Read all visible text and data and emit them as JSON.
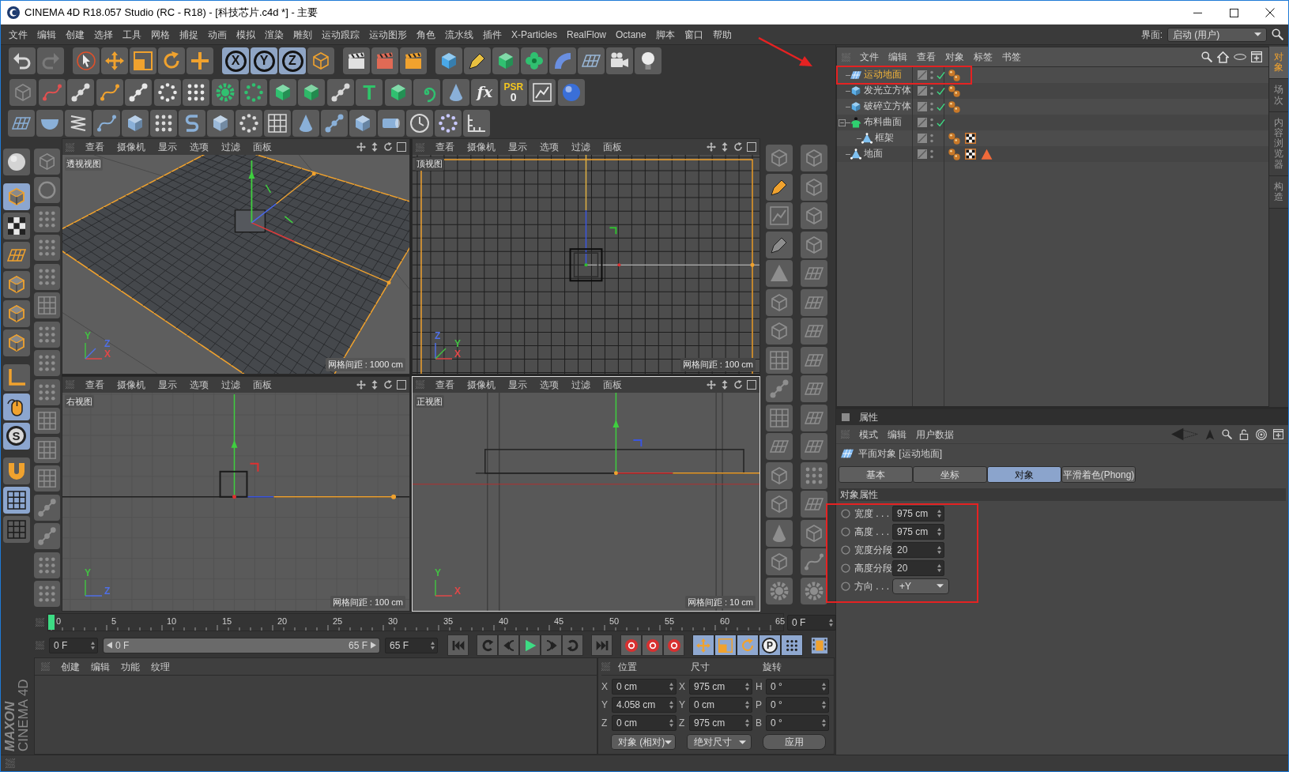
{
  "window": {
    "title": "CINEMA 4D R18.057 Studio (RC - R18) - [科技芯片.c4d *] - 主要"
  },
  "menu_bar": {
    "items": [
      "文件",
      "编辑",
      "创建",
      "选择",
      "工具",
      "网格",
      "捕捉",
      "动画",
      "模拟",
      "渲染",
      "雕刻",
      "运动跟踪",
      "运动图形",
      "角色",
      "流水线",
      "插件",
      "X-Particles",
      "RealFlow",
      "Octane",
      "脚本",
      "窗口",
      "帮助"
    ],
    "layout_label": "界面:",
    "layout_value": "启动 (用户)"
  },
  "toolbar": {
    "axis_buttons": [
      {
        "label": "X",
        "on": true
      },
      {
        "label": "Y",
        "on": true
      },
      {
        "label": "Z",
        "on": true
      }
    ],
    "text_tool": "T",
    "fx": "fx",
    "psr": {
      "label": "PSR",
      "value": "0"
    }
  },
  "left_toolbar": {
    "tools": [
      {
        "kind": "sphere",
        "selected": false
      },
      {
        "kind": "cube",
        "selected": true
      },
      {
        "kind": "checker",
        "selected": false
      },
      {
        "kind": "grid-plane",
        "selected": false
      },
      {
        "kind": "cube",
        "selected": false
      },
      {
        "kind": "cube",
        "selected": false
      },
      {
        "kind": "cube",
        "selected": false
      },
      {
        "kind": "axis",
        "selected": false
      },
      {
        "kind": "mouse",
        "selected": true
      },
      {
        "kind": "snap",
        "label": "S",
        "selected": true
      },
      {
        "kind": "magnet",
        "selected": false
      },
      {
        "kind": "grid",
        "selected": true
      },
      {
        "kind": "grid",
        "selected": false
      }
    ]
  },
  "viewports": [
    {
      "kind": "perspective",
      "active": false,
      "menu": [
        "查看",
        "摄像机",
        "显示",
        "选项",
        "过滤",
        "面板"
      ],
      "name": "透视视图",
      "grid_spacing": "网格间距 : 1000 cm",
      "axes": [
        {
          "label": "Y",
          "color": "#43c043"
        },
        {
          "label": "Z",
          "color": "#4f6fe6"
        },
        {
          "label": "X",
          "color": "#e04848"
        }
      ]
    },
    {
      "kind": "top",
      "active": false,
      "menu": [
        "查看",
        "摄像机",
        "显示",
        "选项",
        "过滤",
        "面板"
      ],
      "name": "顶视图",
      "grid_spacing": "网格间距 : 100 cm",
      "axes": [
        {
          "label": "Z",
          "color": "#4f6fe6"
        },
        {
          "label": "Y",
          "color": "#43c043"
        },
        {
          "label": "X",
          "color": "#e04848"
        }
      ]
    },
    {
      "kind": "right",
      "active": false,
      "menu": [
        "查看",
        "摄像机",
        "显示",
        "选项",
        "过滤",
        "面板"
      ],
      "name": "右视图",
      "grid_spacing": "网格间距 : 100 cm",
      "axes": [
        {
          "label": "Y",
          "color": "#43c043"
        },
        {
          "label": "Z",
          "color": "#4f6fe6"
        }
      ]
    },
    {
      "kind": "front",
      "active": true,
      "menu": [
        "查看",
        "摄像机",
        "显示",
        "选项",
        "过滤",
        "面板"
      ],
      "name": "正视图",
      "grid_spacing": "网格间距 : 10 cm",
      "axes": [
        {
          "label": "Y",
          "color": "#43c043"
        },
        {
          "label": "X",
          "color": "#e04848"
        }
      ]
    }
  ],
  "timeline": {
    "ticks": [
      "0",
      "5",
      "10",
      "15",
      "20",
      "25",
      "30",
      "35",
      "40",
      "45",
      "50",
      "55",
      "60",
      "65"
    ],
    "level": 0,
    "frame": "0 F"
  },
  "frame_controls": {
    "current": "0 F",
    "range": {
      "start": "0 F",
      "end": "65 F",
      "level": 1
    },
    "end": "65 F",
    "key_toggles": [
      {
        "kind": "move",
        "on": true
      },
      {
        "kind": "scale",
        "on": true
      },
      {
        "kind": "rotate",
        "on": true
      },
      {
        "kind": "param",
        "label": "P",
        "on": true
      },
      {
        "kind": "points",
        "on": true
      }
    ]
  },
  "material_manager": {
    "menu": [
      "创建",
      "编辑",
      "功能",
      "纹理"
    ]
  },
  "logo": {
    "brand": "MAXON",
    "product": "CINEMA 4D"
  },
  "coordinates": {
    "headers": [
      "位置",
      "尺寸",
      "旋转"
    ],
    "rows": [
      {
        "position_axis": "X",
        "position": "0 cm",
        "size_axis": "X",
        "size": "975 cm",
        "rotation_axis": "H",
        "rotation": "0 °"
      },
      {
        "position_axis": "Y",
        "position": "4.058 cm",
        "size_axis": "Y",
        "size": "0 cm",
        "rotation_axis": "P",
        "rotation": "0 °"
      },
      {
        "position_axis": "Z",
        "position": "0 cm",
        "size_axis": "Z",
        "size": "975 cm",
        "rotation_axis": "B",
        "rotation": "0 °"
      }
    ],
    "mode": "对象 (相对)",
    "size_mode": "绝对尺寸",
    "apply": "应用"
  },
  "object_manager": {
    "menu": [
      "文件",
      "编辑",
      "查看",
      "对象",
      "标签",
      "书签"
    ],
    "objects": [
      {
        "name": "运动地面",
        "kind": "plane",
        "selected": true,
        "enabled": true,
        "tags": [
          {
            "kind": "dots"
          }
        ]
      },
      {
        "name": "发光立方体",
        "kind": "cube",
        "selected": false,
        "enabled": true,
        "tags": [
          {
            "kind": "dots"
          }
        ]
      },
      {
        "name": "破碎立方体",
        "kind": "cube",
        "selected": false,
        "enabled": true,
        "tags": [
          {
            "kind": "dots"
          }
        ]
      },
      {
        "name": "布料曲面",
        "kind": "cloth",
        "selected": false,
        "enabled": true,
        "expanded": true,
        "children": [
          {
            "name": "框架",
            "kind": "mesh",
            "selected": false,
            "enabled": false,
            "tags": [
              {
                "kind": "dots"
              },
              {
                "kind": "checker"
              }
            ]
          }
        ]
      },
      {
        "name": "地面",
        "kind": "mesh",
        "selected": false,
        "enabled": false,
        "tags": [
          {
            "kind": "dots"
          },
          {
            "kind": "checker"
          },
          {
            "kind": "triangle"
          }
        ]
      }
    ]
  },
  "side_tabs": [
    {
      "label": "对象",
      "selected": true
    },
    {
      "label": "场次",
      "selected": false
    },
    {
      "label": "内容浏览器",
      "selected": false
    },
    {
      "label": "构造",
      "selected": false
    }
  ],
  "attributes": {
    "title": "属性",
    "menu": [
      "模式",
      "编辑",
      "用户数据"
    ],
    "object_label": "平面对象 [运动地面]",
    "tabs": [
      {
        "label": "基本",
        "selected": false
      },
      {
        "label": "坐标",
        "selected": false
      },
      {
        "label": "对象",
        "selected": true
      },
      {
        "label": "平滑着色(Phong)",
        "selected": false
      }
    ],
    "section": "对象属性",
    "fields": [
      {
        "label": "宽度 . . .",
        "value": "975 cm",
        "kind": "number"
      },
      {
        "label": "高度 . . .",
        "value": "975 cm",
        "kind": "number"
      },
      {
        "label": "宽度分段",
        "value": "20",
        "kind": "number"
      },
      {
        "label": "高度分段",
        "value": "20",
        "kind": "number"
      },
      {
        "label": "方向 . . .",
        "value": "+Y",
        "kind": "dropdown"
      }
    ]
  }
}
